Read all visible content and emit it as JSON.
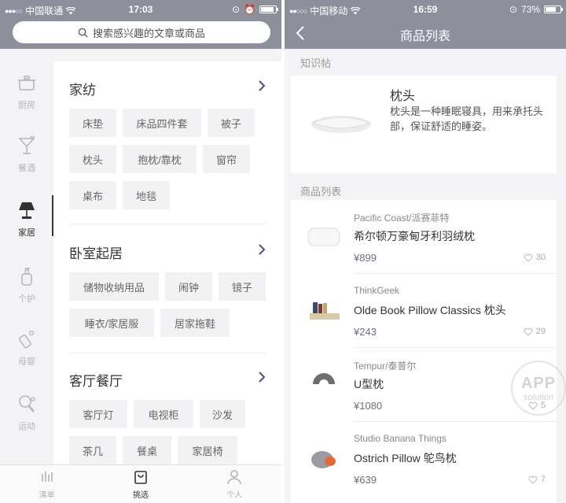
{
  "left": {
    "status": {
      "carrier": "中国联通",
      "time": "17:03"
    },
    "search": {
      "placeholder": "搜索感兴趣的文章或商品"
    },
    "categories": [
      {
        "label": "厨房",
        "icon": "pot-icon"
      },
      {
        "label": "餐酒",
        "icon": "cocktail-icon"
      },
      {
        "label": "家居",
        "icon": "lamp-icon",
        "active": true
      },
      {
        "label": "个护",
        "icon": "pump-bottle-icon"
      },
      {
        "label": "母婴",
        "icon": "baby-bottle-icon"
      },
      {
        "label": "运动",
        "icon": "ping-pong-icon"
      }
    ],
    "sections": [
      {
        "title": "家纺",
        "tags": [
          "床垫",
          "床品四件套",
          "被子",
          "枕头",
          "抱枕/靠枕",
          "窗帘",
          "桌布",
          "地毯"
        ]
      },
      {
        "title": "卧室起居",
        "tags": [
          "储物收纳用品",
          "闹钟",
          "镜子",
          "睡衣/家居服",
          "居家拖鞋"
        ]
      },
      {
        "title": "客厅餐厅",
        "tags": [
          "客厅灯",
          "电视柜",
          "沙发",
          "茶几",
          "餐桌",
          "家居椅"
        ]
      }
    ],
    "tabs": [
      {
        "label": "清单",
        "icon": "bars-icon"
      },
      {
        "label": "挑选",
        "icon": "bag-icon",
        "active": true
      },
      {
        "label": "个人",
        "icon": "person-icon"
      }
    ]
  },
  "right": {
    "status": {
      "carrier": "中国移动",
      "time": "16:59",
      "battery": "73%"
    },
    "nav_title": "商品列表",
    "knowledge_label": "知识帖",
    "knowledge": {
      "title": "枕头",
      "desc": "枕头是一种睡眠寝具，用来承托头部，保证舒适的睡姿。"
    },
    "list_label": "商品列表",
    "products": [
      {
        "brand": "Pacific Coast/派赛菲特",
        "name": "希尔顿万豪甸牙利羽绒枕",
        "price": "¥899",
        "likes": "30"
      },
      {
        "brand": "ThinkGeek",
        "name": "Olde Book Pillow Classics 枕头",
        "price": "¥243",
        "likes": "29"
      },
      {
        "brand": "Tempur/泰普尔",
        "name": "U型枕",
        "price": "¥1080",
        "likes": "5"
      },
      {
        "brand": "Studio Banana Things",
        "name": "Ostrich Pillow 鸵鸟枕",
        "price": "¥639",
        "likes": "7"
      }
    ]
  },
  "watermark": {
    "line1": "APP",
    "line2": "solution"
  },
  "colors": {
    "bar": "#8d8f9b",
    "tag_bg": "#f2f2f4",
    "price": "#6d6f7c"
  }
}
